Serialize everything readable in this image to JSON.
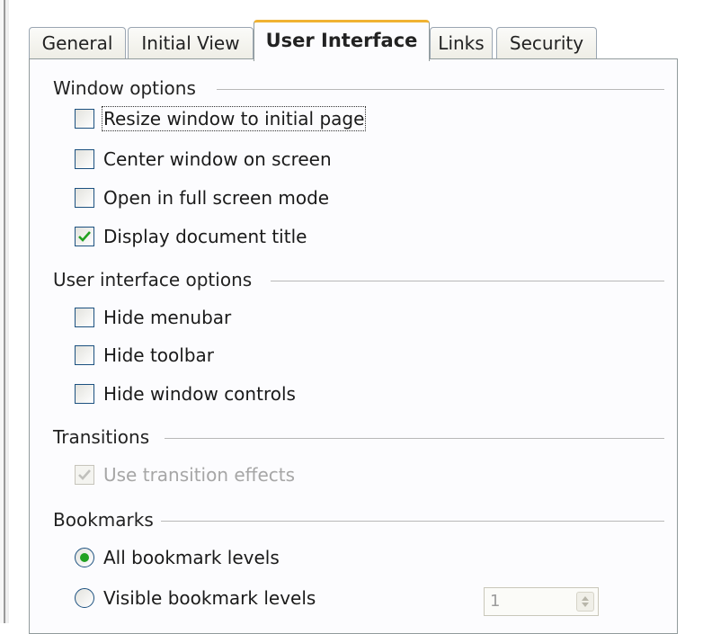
{
  "tabs": [
    {
      "label": "General"
    },
    {
      "label": "Initial View"
    },
    {
      "label": "User Interface"
    },
    {
      "label": "Links"
    },
    {
      "label": "Security"
    }
  ],
  "active_tab": "User Interface",
  "window_options": {
    "title": "Window options",
    "items": [
      {
        "label": "Resize window to initial page",
        "checked": false
      },
      {
        "label": "Center window on screen",
        "checked": false
      },
      {
        "label": "Open in full screen mode",
        "checked": false
      },
      {
        "label": "Display document title",
        "checked": true
      }
    ]
  },
  "ui_options": {
    "title": "User interface options",
    "items": [
      {
        "label": "Hide menubar",
        "checked": false
      },
      {
        "label": "Hide toolbar",
        "checked": false
      },
      {
        "label": "Hide window controls",
        "checked": false
      }
    ]
  },
  "transitions": {
    "title": "Transitions",
    "items": [
      {
        "label": "Use transition effects",
        "checked": true,
        "enabled": false
      }
    ]
  },
  "bookmarks": {
    "title": "Bookmarks",
    "options": [
      {
        "label": "All bookmark levels",
        "selected": true
      },
      {
        "label": "Visible bookmark levels",
        "selected": false
      }
    ],
    "levels_value": "1"
  },
  "colors": {
    "active_tab_accent": "#f0b232",
    "checkbox_border": "#1c5180",
    "check_mark": "#21a121",
    "radio_dot": "#21a121"
  }
}
